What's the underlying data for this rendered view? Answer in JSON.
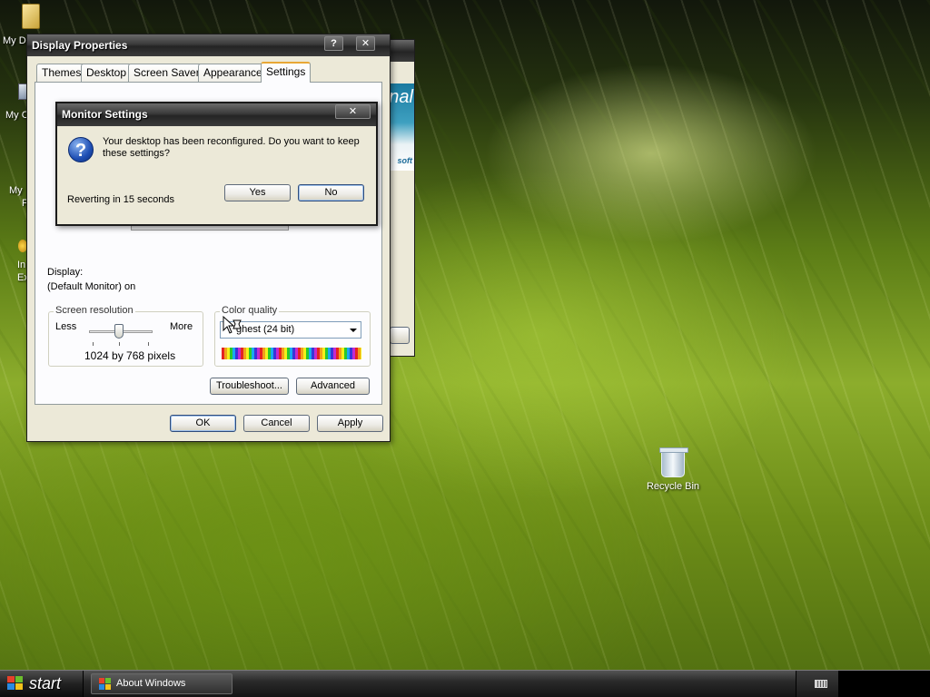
{
  "desktop": {
    "icons": [
      {
        "label": "My D"
      },
      {
        "label": "My C"
      },
      {
        "label": "My"
      },
      {
        "label": "F"
      },
      {
        "label": "In"
      },
      {
        "label": "Ex"
      }
    ],
    "recycle_bin": {
      "label": "Recycle Bin",
      "icon": "recycle-bin-icon"
    }
  },
  "background_window": {
    "banner_text": "nal",
    "banner_subtext": "soft"
  },
  "display_properties": {
    "title": "Display Properties",
    "help_button": "?",
    "close_button": "✕",
    "tabs": [
      {
        "label": "Themes"
      },
      {
        "label": "Desktop"
      },
      {
        "label": "Screen Saver"
      },
      {
        "label": "Appearance"
      },
      {
        "label": "Settings",
        "active": true
      }
    ],
    "display_label": "Display:",
    "display_value": "(Default Monitor) on",
    "screen_resolution": {
      "group_label": "Screen resolution",
      "less": "Less",
      "more": "More",
      "value": "1024 by 768 pixels"
    },
    "color_quality": {
      "group_label": "Color quality",
      "selected": "ghest (24 bit)"
    },
    "troubleshoot_button": "Troubleshoot...",
    "advanced_button": "Advanced",
    "ok_button": "OK",
    "cancel_button": "Cancel",
    "apply_button": "Apply"
  },
  "monitor_settings": {
    "title": "Monitor Settings",
    "close_button": "✕",
    "icon": "question-icon",
    "message": "Your desktop has been reconfigured.  Do you want to keep these settings?",
    "countdown": "Reverting in 15 seconds",
    "yes_button": "Yes",
    "no_button": "No"
  },
  "taskbar": {
    "start_label": "start",
    "tasks": [
      {
        "label": "About Windows"
      }
    ]
  },
  "colors": {
    "titlebar_dark": "#242424",
    "dialog_bg": "#ece9d8",
    "default_button_ring": "#9ec0ea",
    "grass_green": "#8cad2c"
  }
}
